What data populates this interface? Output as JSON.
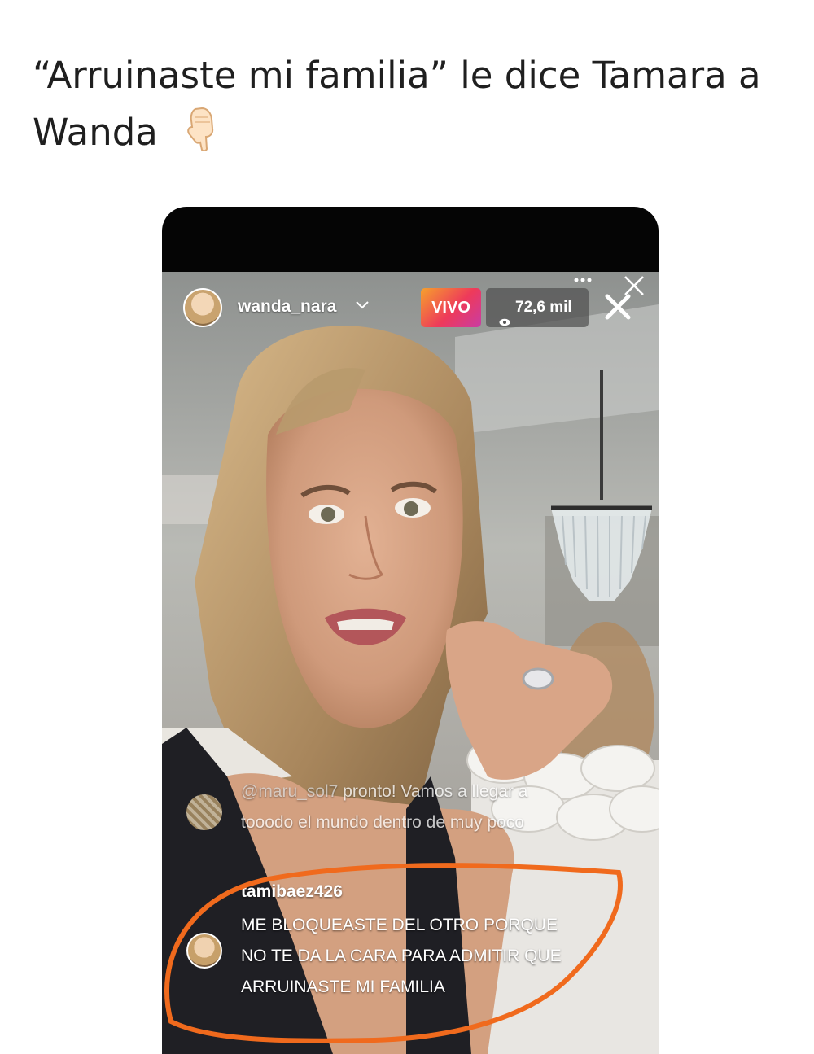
{
  "tweet": {
    "text": "“Arruinaste mi familia” le dice Tamara a Wanda"
  },
  "live": {
    "username": "wanda_nara",
    "live_label": "VIVO",
    "viewers": "72,6 mil"
  },
  "comments": [
    {
      "user": "@maru_sol7",
      "text": "pronto! Vamos a llegar a tooodo el mundo dentro de muy poco"
    },
    {
      "user": "tamibaez426",
      "text": "ME BLOQUEASTE DEL OTRO PORQUE NO TE DA LA CARA PARA ADMITIR QUE ARRUINASTE MI FAMILIA"
    }
  ],
  "colors": {
    "annotation_circle": "#f06a1d",
    "live_gradient": [
      "#f6a12c",
      "#ee3a5a",
      "#c93ca4"
    ]
  }
}
